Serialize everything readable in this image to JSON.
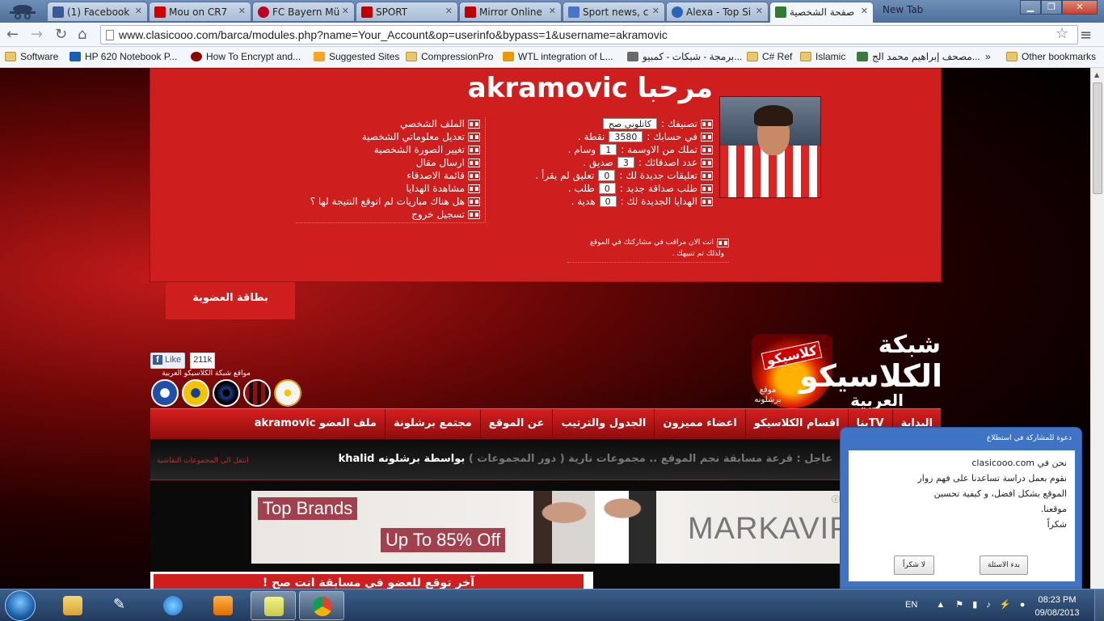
{
  "browser": {
    "tabs": [
      {
        "title": "(1) Facebook",
        "color": "#3b5998"
      },
      {
        "title": "Mou on CR7",
        "color": "#d00000"
      },
      {
        "title": "FC Bayern Mü",
        "color": "#c00020"
      },
      {
        "title": "SPORT",
        "color": "#c00000"
      },
      {
        "title": "Mirror Online",
        "color": "#c00000"
      },
      {
        "title": "Sport news, c",
        "color": "#4a74c9"
      },
      {
        "title": "Alexa - Top Si",
        "color": "#2a63b8"
      },
      {
        "title": "صفحة الشخصية",
        "color": "#2e7d32"
      }
    ],
    "new_tab_label": "New Tab",
    "url": "www.clasicooo.com/barca/modules.php?name=Your_Account&op=userinfo&bypass=1&username=akramovic",
    "bookmarks": [
      "Software",
      "HP 620 Notebook P...",
      "How To Encrypt and...",
      "Suggested Sites",
      "CompressionPro",
      "WTL integration of L...",
      "برمجة - شبكات - كمبيو...",
      "C# Ref",
      "Islamic",
      "مصحف إبراهيم محمد الج..."
    ],
    "more_bookmarks": "»",
    "other_bookmarks": "Other bookmarks"
  },
  "profile": {
    "welcome_title": "مرحبا akramovic",
    "stats": [
      {
        "label": "تصنيفك :",
        "value": "كاتلوني صح",
        "suffix": ""
      },
      {
        "label": "في حسابك :",
        "value": "3580",
        "suffix": "نقطة ."
      },
      {
        "label": "تملك من الاوسمة :",
        "value": "1",
        "suffix": "وسام ."
      },
      {
        "label": "عدد اصدقائك :",
        "value": "3",
        "suffix": "صديق ."
      },
      {
        "label": "تعليقات جديدة لك :",
        "value": "0",
        "suffix": "تعليق لم يقرأ ."
      },
      {
        "label": "طلب صداقة جديد :",
        "value": "0",
        "suffix": "طلب ."
      },
      {
        "label": "الهدايا الجديدة لك :",
        "value": "0",
        "suffix": "هدية ."
      }
    ],
    "links": [
      "الملف الشخصي",
      "تعديل معلوماتي الشخصية",
      "تغيير الصورة الشخصية",
      "ارسال مقال",
      "قائمة الاصدقاء",
      "مشاهدة الهدايا",
      "هل هناك مباريات لم اتوقع النتيجة لها ؟",
      "تسجيل خروج"
    ],
    "notice_line1": "انت الان مراقب في مشاركتك في الموقع",
    "notice_line2": "ولذلك تم تنبيهك .",
    "card_tab": "بطاقة العضوية"
  },
  "site": {
    "logo_line1": "شبكة",
    "logo_line2": "الكلاسيكو",
    "logo_line3": "العربية",
    "logo_badge": "كلاسيكو",
    "logo_sub": "موقع برشلونه",
    "like_label": "Like",
    "like_count": "211k",
    "sites_caption": "مواقع شبكة الكلاسيكو العربية",
    "clubs": [
      {
        "name": "Al-Hilal",
        "color": "#1f4fa8"
      },
      {
        "name": "Al-Nassr",
        "color": "#f2c500"
      },
      {
        "name": "Inter",
        "color": "#1a3d8f"
      },
      {
        "name": "Milan",
        "color": "#b30000"
      },
      {
        "name": "Real Madrid",
        "color": "#f4f4f4"
      }
    ],
    "nav": [
      "البداية",
      "TVينا",
      "اقسام الكلاسيكو",
      "اعضاء مميزون",
      "الجدول والترتيب",
      "عن الموقع",
      "مجتمع برشلونة",
      "ملف العضو akramovic"
    ],
    "ticker_prefix": "عاجل : قرعة مسابقة نجم الموقع .. مجموعات نارية ( دور المجموعات ) ",
    "ticker_by": "بواسطة برشلونه khalid",
    "groups_link": "انتقل الى المجموعات النقاشية",
    "contest_title": "آخر توقع للعضو في مسابقة انت صح !"
  },
  "ad": {
    "top_brands": "Top Brands",
    "offer": "Up To 85% Off",
    "brand": "MARKAVIP",
    "info_icon": "info-icon"
  },
  "survey": {
    "header": "دعوة للمشاركة في استطلاع",
    "line1": "نحن في clasicooo.com",
    "line2": "نقوم بعمل دراسة تساعدنا على فهم زوار",
    "line3": "الموقع بشكل افضل، و كيفية تحسين",
    "line4": "موقعنا.",
    "line5": "شكراً",
    "start_button": "بدء الاسئلة",
    "decline_button": "لا شكراً"
  },
  "taskbar": {
    "language": "EN",
    "time": "08:23 PM",
    "date": "09/08/2013"
  }
}
